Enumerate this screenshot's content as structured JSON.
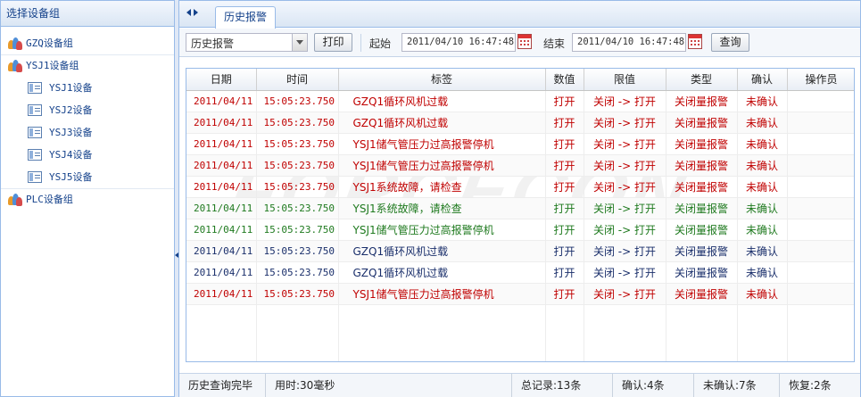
{
  "left_panel": {
    "title": "选择设备组",
    "groups": [
      {
        "label": "GZQ设备组",
        "children": []
      },
      {
        "label": "YSJ1设备组",
        "children": [
          "YSJ1设备",
          "YSJ2设备",
          "YSJ3设备",
          "YSJ4设备",
          "YSJ5设备"
        ]
      },
      {
        "label": "PLC设备组",
        "children": []
      }
    ]
  },
  "tabs": {
    "active": "历史报警"
  },
  "toolbar": {
    "alarm_type_value": "历史报警",
    "print_label": "打印",
    "start_label": "起始",
    "start_value": "2011/04/10 16:47:48",
    "end_label": "结束",
    "end_value": "2011/04/10 16:47:48",
    "query_label": "查询"
  },
  "grid": {
    "columns": [
      "日期",
      "时间",
      "标签",
      "数值",
      "限值",
      "类型",
      "确认",
      "操作员"
    ],
    "watermark": "FORCECON",
    "rows": [
      {
        "date": "2011/04/11",
        "time": "15:05:23.750",
        "tag": "GZQ1循环风机过载",
        "value": "打开",
        "limit": "关闭 -> 打开",
        "type": "关闭量报警",
        "confirm": "未确认",
        "operator": "",
        "color": "#c00000"
      },
      {
        "date": "2011/04/11",
        "time": "15:05:23.750",
        "tag": "GZQ1循环风机过载",
        "value": "打开",
        "limit": "关闭 -> 打开",
        "type": "关闭量报警",
        "confirm": "未确认",
        "operator": "",
        "color": "#c00000"
      },
      {
        "date": "2011/04/11",
        "time": "15:05:23.750",
        "tag": "YSJ1储气管压力过高报警停机",
        "value": "打开",
        "limit": "关闭 -> 打开",
        "type": "关闭量报警",
        "confirm": "未确认",
        "operator": "",
        "color": "#c00000"
      },
      {
        "date": "2011/04/11",
        "time": "15:05:23.750",
        "tag": "YSJ1储气管压力过高报警停机",
        "value": "打开",
        "limit": "关闭 -> 打开",
        "type": "关闭量报警",
        "confirm": "未确认",
        "operator": "",
        "color": "#c00000"
      },
      {
        "date": "2011/04/11",
        "time": "15:05:23.750",
        "tag": "YSJ1系统故障，请检查",
        "value": "打开",
        "limit": "关闭 -> 打开",
        "type": "关闭量报警",
        "confirm": "未确认",
        "operator": "",
        "color": "#c00000"
      },
      {
        "date": "2011/04/11",
        "time": "15:05:23.750",
        "tag": "YSJ1系统故障，请检查",
        "value": "打开",
        "limit": "关闭 -> 打开",
        "type": "关闭量报警",
        "confirm": "未确认",
        "operator": "",
        "color": "#1f7a1f"
      },
      {
        "date": "2011/04/11",
        "time": "15:05:23.750",
        "tag": "YSJ1储气管压力过高报警停机",
        "value": "打开",
        "limit": "关闭 -> 打开",
        "type": "关闭量报警",
        "confirm": "未确认",
        "operator": "",
        "color": "#1f7a1f"
      },
      {
        "date": "2011/04/11",
        "time": "15:05:23.750",
        "tag": "GZQ1循环风机过载",
        "value": "打开",
        "limit": "关闭 -> 打开",
        "type": "关闭量报警",
        "confirm": "未确认",
        "operator": "",
        "color": "#1a2f6b"
      },
      {
        "date": "2011/04/11",
        "time": "15:05:23.750",
        "tag": "GZQ1循环风机过载",
        "value": "打开",
        "limit": "关闭 -> 打开",
        "type": "关闭量报警",
        "confirm": "未确认",
        "operator": "",
        "color": "#1a2f6b"
      },
      {
        "date": "2011/04/11",
        "time": "15:05:23.750",
        "tag": "YSJ1储气管压力过高报警停机",
        "value": "打开",
        "limit": "关闭 -> 打开",
        "type": "关闭量报警",
        "confirm": "未确认",
        "operator": "",
        "color": "#c00000"
      }
    ]
  },
  "status": {
    "message": "历史查询完毕",
    "elapsed": "用时:30毫秒",
    "total": "总记录:13条",
    "confirmed": "确认:4条",
    "unconfirmed": "未确认:7条",
    "restored": "恢复:2条"
  }
}
